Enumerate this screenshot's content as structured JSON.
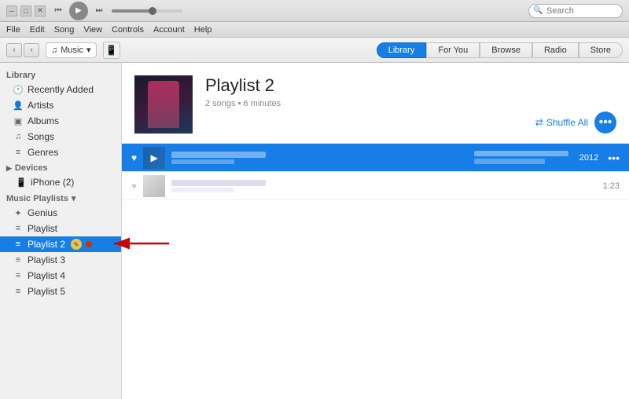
{
  "titleBar": {
    "playback": {
      "rewind_label": "⏮",
      "play_label": "▶",
      "forward_label": "⏭"
    },
    "apple_logo": "",
    "search_placeholder": "Search",
    "minimize_label": "─",
    "maximize_label": "□",
    "close_label": "✕"
  },
  "menuBar": {
    "items": [
      "File",
      "Edit",
      "Song",
      "View",
      "Controls",
      "Account",
      "Help"
    ]
  },
  "toolbar": {
    "back_label": "‹",
    "forward_label": "›",
    "source_icon": "♫",
    "source_label": "Music",
    "device_icon": "📱",
    "tabs": [
      {
        "id": "library",
        "label": "Library",
        "active": true
      },
      {
        "id": "for-you",
        "label": "For You",
        "active": false
      },
      {
        "id": "browse",
        "label": "Browse",
        "active": false
      },
      {
        "id": "radio",
        "label": "Radio",
        "active": false
      },
      {
        "id": "store",
        "label": "Store",
        "active": false
      }
    ]
  },
  "sidebar": {
    "library_header": "Library",
    "library_items": [
      {
        "id": "recently-added",
        "label": "Recently Added",
        "icon": "🕐"
      },
      {
        "id": "artists",
        "label": "Artists",
        "icon": "👤"
      },
      {
        "id": "albums",
        "label": "Albums",
        "icon": "▣"
      },
      {
        "id": "songs",
        "label": "Songs",
        "icon": "♫"
      },
      {
        "id": "genres",
        "label": "Genres",
        "icon": "≡"
      }
    ],
    "devices_header": "Devices",
    "devices": [
      {
        "id": "iphone",
        "label": "iPhone (2)",
        "icon": "📱"
      }
    ],
    "playlists_header": "Music Playlists",
    "playlists": [
      {
        "id": "genius",
        "label": "Genius",
        "icon": "✦"
      },
      {
        "id": "playlist",
        "label": "Playlist",
        "icon": "≡"
      },
      {
        "id": "playlist2",
        "label": "Playlist 2",
        "icon": "≡",
        "active": true
      },
      {
        "id": "playlist3",
        "label": "Playlist 3",
        "icon": "≡"
      },
      {
        "id": "playlist4",
        "label": "Playlist 4",
        "icon": "≡"
      },
      {
        "id": "playlist5",
        "label": "Playlist 5",
        "icon": "≡"
      }
    ]
  },
  "content": {
    "playlist": {
      "title": "Playlist 2",
      "meta": "2 songs • 6 minutes",
      "shuffle_label": "Shuffle All",
      "more_label": "•••"
    },
    "tracks": [
      {
        "id": "track1",
        "playing": true,
        "year": "2012",
        "duration": "",
        "more": "•••"
      },
      {
        "id": "track2",
        "playing": false,
        "year": "",
        "duration": "1:23",
        "more": ""
      }
    ]
  },
  "icons": {
    "heart": "♥",
    "shuffle": "⇄",
    "more": "•••",
    "play_small": "▶",
    "chevron_down": "▾",
    "chevron_right": "›",
    "edit": "✎"
  }
}
